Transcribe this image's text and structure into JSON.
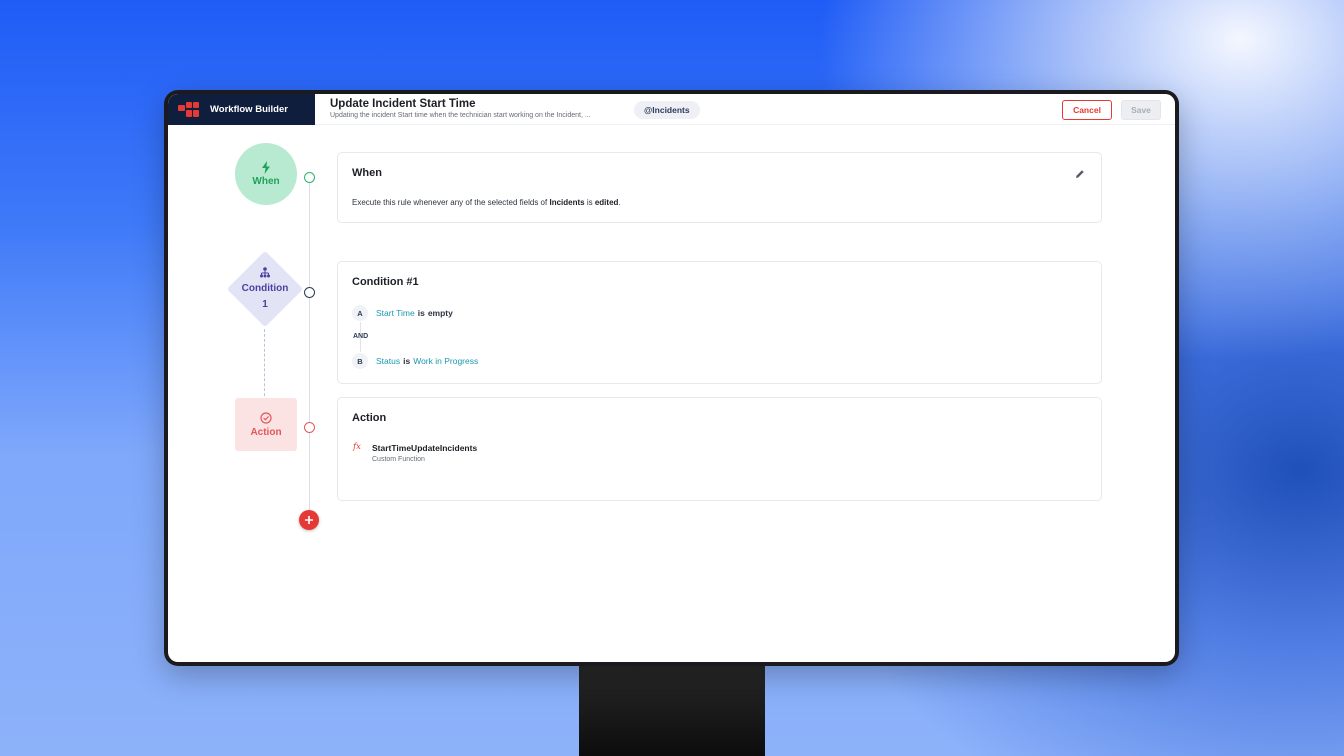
{
  "header": {
    "brand_title": "Workflow Builder",
    "workflow_title": "Update Incident Start Time",
    "workflow_description": "Updating the incident Start time when the technician start working on the Incident, ...",
    "module_chip": "@Incidents",
    "cancel_label": "Cancel",
    "save_label": "Save"
  },
  "nodes": {
    "when_label": "When",
    "condition_label": "Condition",
    "condition_number": "1",
    "action_label": "Action"
  },
  "when_card": {
    "title": "When",
    "text_prefix": "Execute this rule whenever any of the selected fields of",
    "module": "Incidents",
    "text_mid": "is",
    "event": "edited",
    "text_suffix": "."
  },
  "condition_card": {
    "title": "Condition #1",
    "criteria": [
      {
        "letter": "A",
        "field": "Start Time",
        "operator": "is",
        "value": "empty"
      },
      {
        "letter": "B",
        "field": "Status",
        "operator": "is",
        "value": "Work in Progress"
      }
    ],
    "join": "AND"
  },
  "action_card": {
    "title": "Action",
    "icon_text": "fx",
    "name": "StartTimeUpdateIncidents",
    "type": "Custom Function"
  },
  "colors": {
    "brand_bg": "#0f1e3d",
    "accent_red": "#e53935",
    "when_green": "#1fa35a",
    "condition_purple": "#4b3fa1",
    "action_red": "#e2575a",
    "field_teal": "#1a98b0"
  },
  "icons": {
    "brand": "workflow-logo-icon",
    "when": "lightning-bolt-icon",
    "condition": "hierarchy-icon",
    "action": "check-circle-icon",
    "edit": "pencil-icon",
    "add": "plus-icon"
  }
}
